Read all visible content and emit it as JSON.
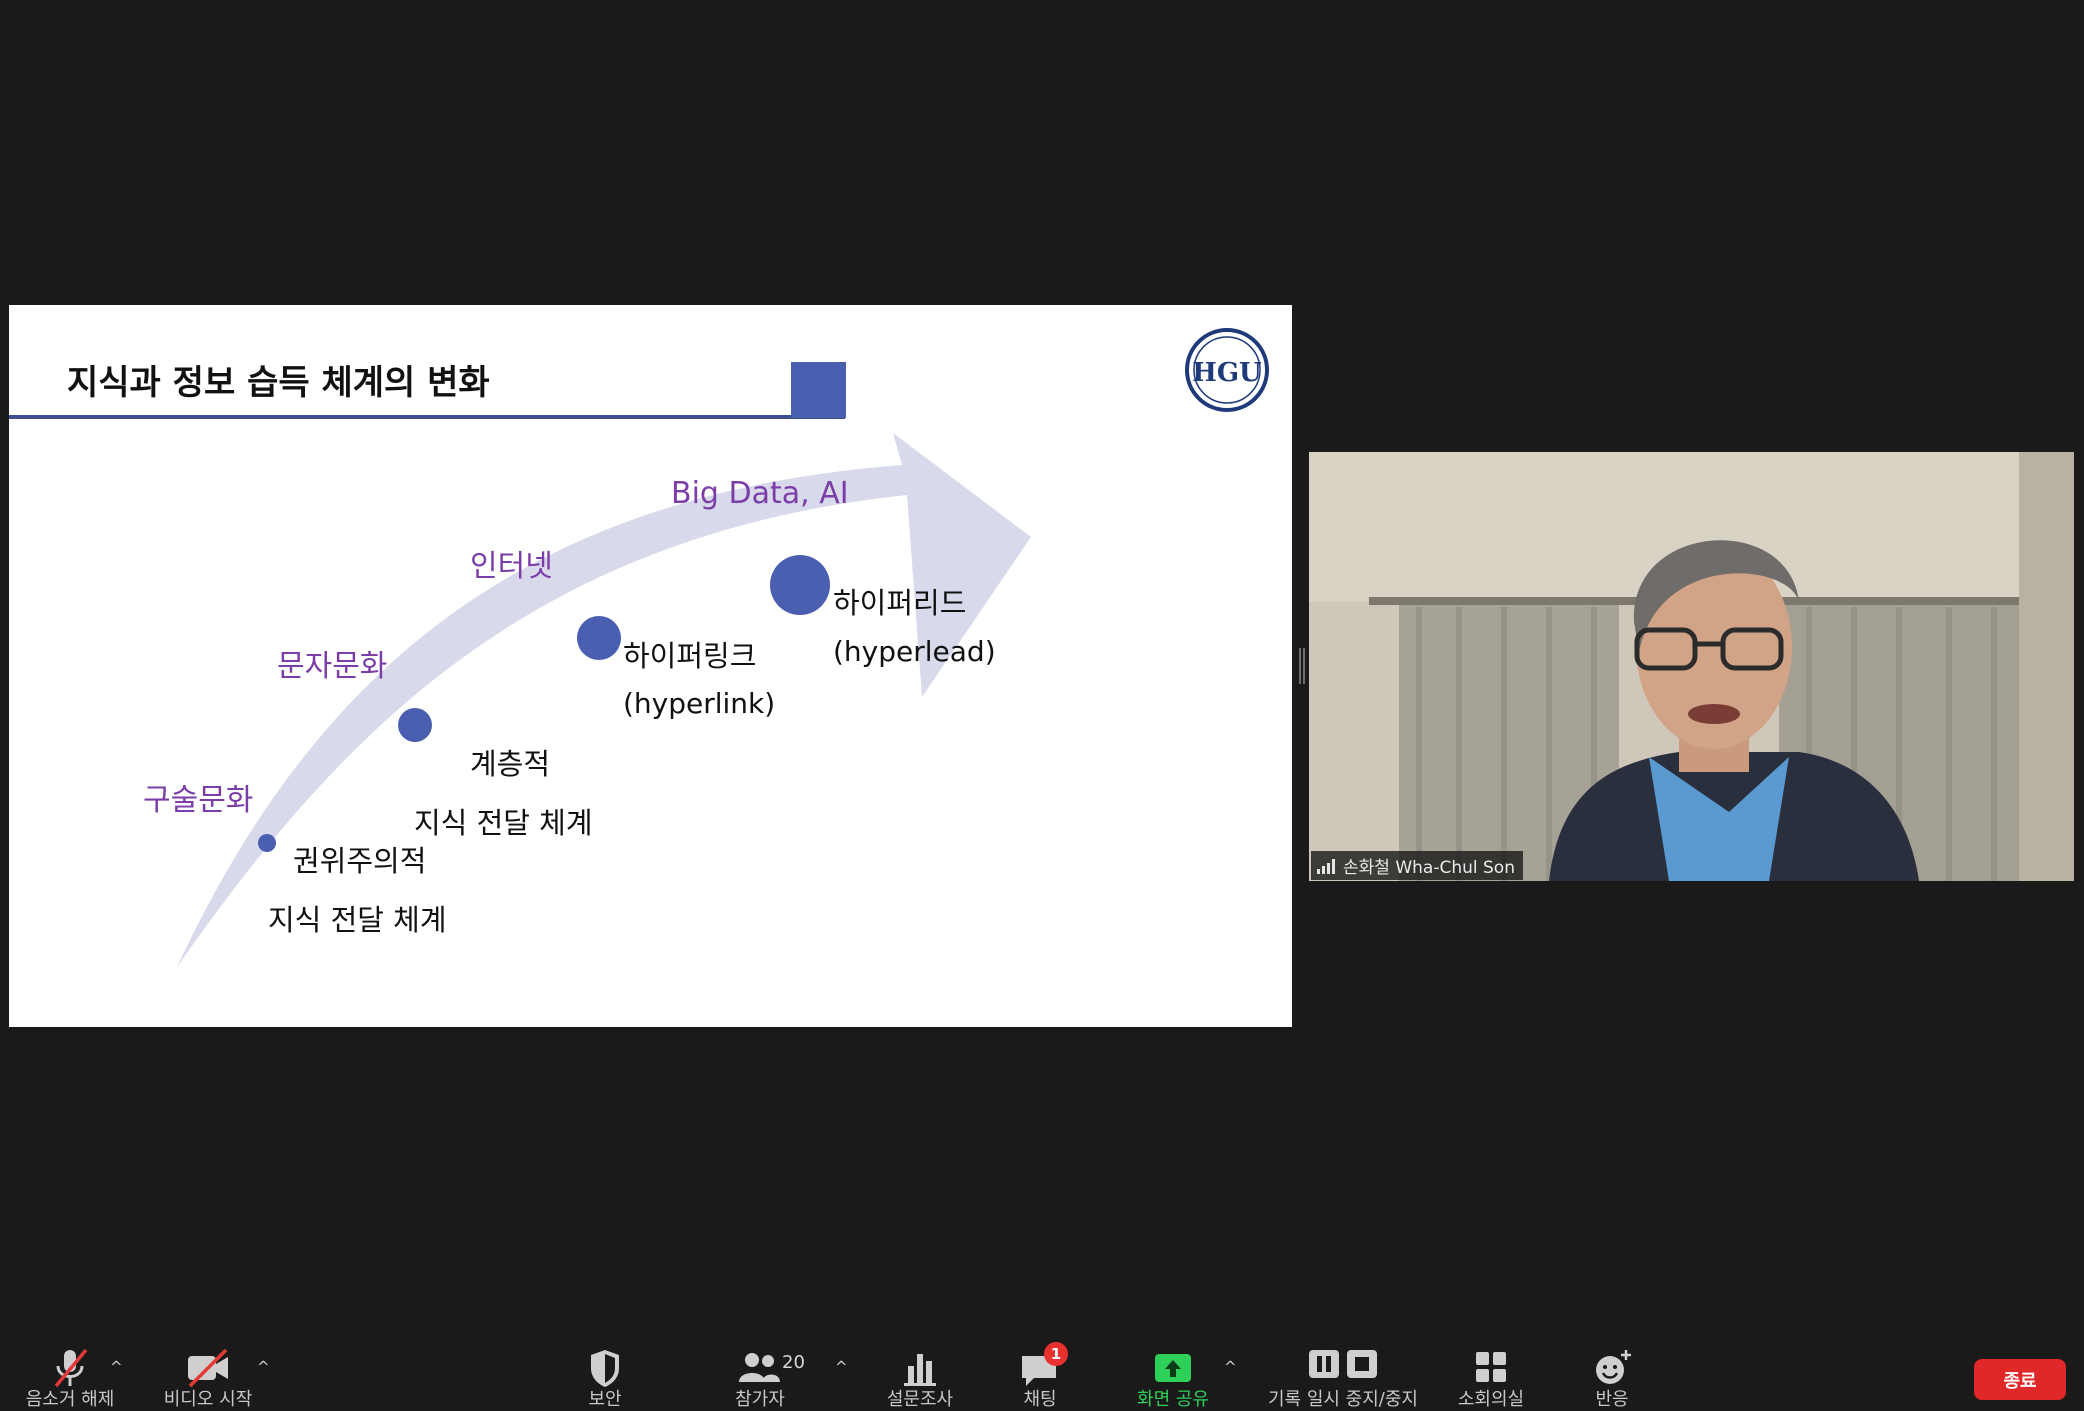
{
  "slide": {
    "title": "지식과 정보 습득 체계의 변화",
    "logo_text": "HGU",
    "stages": [
      {
        "label": "구술문화",
        "desc1": "권위주의적",
        "desc2": "지식 전달 체계"
      },
      {
        "label": "문자문화",
        "desc1": "계층적",
        "desc2": "지식 전달 체계"
      },
      {
        "label": "인터넷",
        "desc1": "하이퍼링크",
        "desc2": "(hyperlink)"
      },
      {
        "label": "Big Data, AI",
        "desc1": "하이퍼리드",
        "desc2": "(hyperlead)"
      }
    ],
    "colors": {
      "accent": "#4a5fb0",
      "label": "#7b3ea8",
      "arrow": "#d8d9ea"
    }
  },
  "participant": {
    "name": "손화철 Wha-Chul Son",
    "signal_icon": "signal-bars-icon"
  },
  "toolbar": {
    "mute_label": "음소거 해제",
    "video_label": "비디오 시작",
    "security_label": "보안",
    "participants_label": "참가자",
    "participants_count": "20",
    "polls_label": "설문조사",
    "chat_label": "채팅",
    "chat_badge": "1",
    "share_label": "화면 공유",
    "record_label": "기록 일시 중지/중지",
    "breakout_label": "소회의실",
    "reactions_label": "반응",
    "end_label": "종료",
    "share_color": "#2fd05a",
    "end_color": "#e02828"
  }
}
